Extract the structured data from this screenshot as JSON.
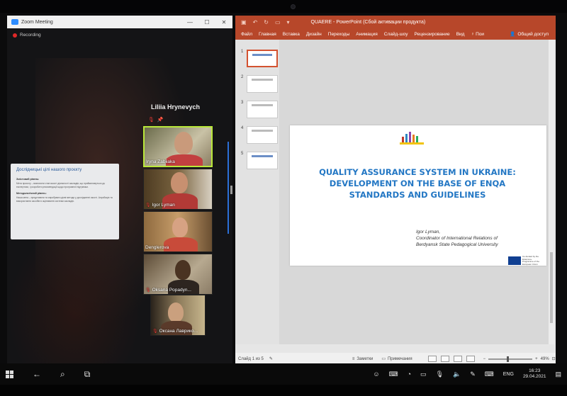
{
  "zoom": {
    "window_title": "Zoom Meeting",
    "recording_label": "Recording",
    "speaker_name": "Liliia Hrynevych",
    "shared_screen": {
      "title": "Дослідницькі цілі нашого проєкту",
      "sections": [
        {
          "heading": "Змістовий рівень:",
          "text": "Мета проєкту – визначити стан якості діяльності закладів, що прийматимуться до експертизи, і розробити рекомендації щодо програмної підтримки."
        },
        {
          "heading": "Методологічний рівень:",
          "text": "Наша мета – представити та апробувати дієві методи у дослідженні якості. Апробація та використання засобів в оцінюванні системи закладів."
        }
      ]
    },
    "participants": [
      {
        "name": "Iryna Zabiiaka",
        "muted": false,
        "active": true
      },
      {
        "name": "Igor Lyman",
        "muted": true,
        "active": false
      },
      {
        "name": "Denglerova",
        "muted": false,
        "active": false
      },
      {
        "name": "Oksana Popadyn...",
        "muted": true,
        "active": false
      },
      {
        "name": "Оксана Лаврико...",
        "muted": true,
        "active": false
      }
    ]
  },
  "powerpoint": {
    "window_title": "QUAERE - PowerPoint (Сбой активации продукта)",
    "ribbon_tabs": [
      "Файл",
      "Главная",
      "Вставка",
      "Дизайн",
      "Переходы",
      "Анимация",
      "Слайд-шоу",
      "Рецензирование",
      "Вид",
      "Пои"
    ],
    "share_label": "Общий доступ",
    "slide_numbers": [
      "1",
      "2",
      "3",
      "4",
      "5"
    ],
    "slide": {
      "title": "QUALITY ASSURANCE SYSTEM IN UKRAINE: DEVELOPMENT ON THE BASE OF ENQA STANDARDS AND GUIDELINES",
      "author_name": "Igor Lyman,",
      "author_role": "Coordinator of International Relations of",
      "author_org": "Berdyansk State Pedagogical University",
      "eu_text": "Co-funded by the Erasmus+ Programme of the European Union"
    },
    "status": {
      "slide_counter": "Слайд 1 из 5",
      "notes_label": "Заметки",
      "comments_label": "Примечания",
      "zoom_level": "49%"
    }
  },
  "taskbar": {
    "language": "ENG",
    "time": "16:23",
    "date": "29.04.2021"
  },
  "colors": {
    "ppt_accent": "#b7472a",
    "slide_title": "#2377c4",
    "active_speaker_border": "#b9e83a",
    "muted_icon": "#e53935"
  }
}
